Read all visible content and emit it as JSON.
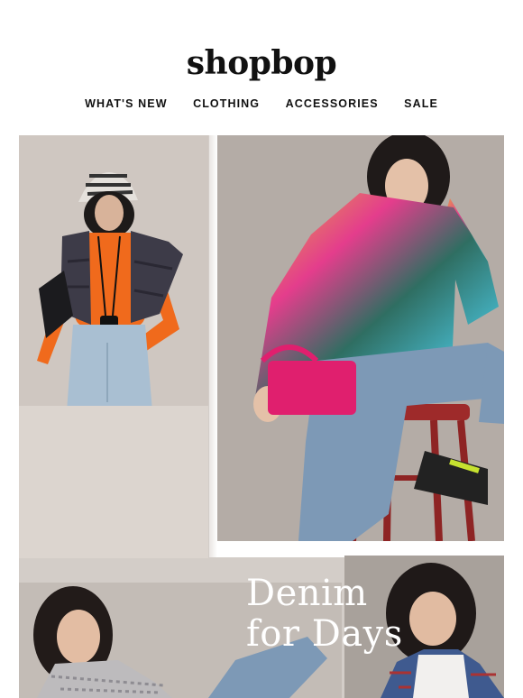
{
  "brand": {
    "logo_text": "shopbop"
  },
  "nav": {
    "items": [
      {
        "label": "WHAT'S NEW"
      },
      {
        "label": "CLOTHING"
      },
      {
        "label": "ACCESSORIES"
      },
      {
        "label": "SALE"
      }
    ]
  },
  "hero": {
    "headline_line1": "Denim",
    "headline_line2": "for Days"
  },
  "colors": {
    "background": "#ffffff",
    "text": "#111111",
    "headline": "#ffffff",
    "studio_backdrop": "#cfc7c1"
  }
}
